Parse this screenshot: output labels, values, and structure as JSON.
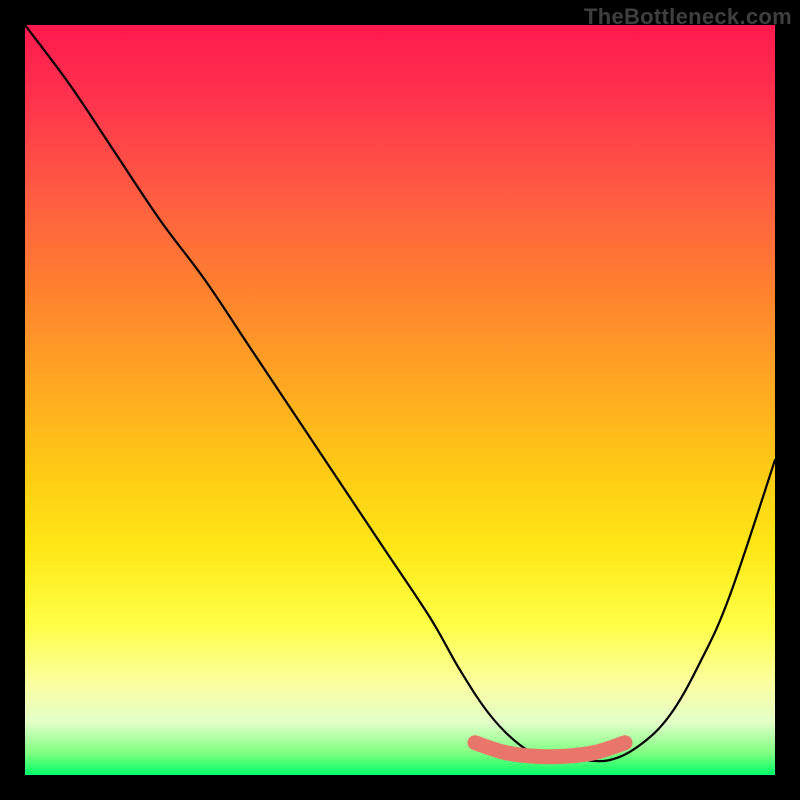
{
  "watermark": "TheBottleneck.com",
  "chart_data": {
    "type": "line",
    "title": "",
    "xlabel": "",
    "ylabel": "",
    "xlim": [
      0,
      100
    ],
    "ylim": [
      0,
      100
    ],
    "series": [
      {
        "name": "bottleneck-curve",
        "x": [
          0,
          6,
          12,
          18,
          24,
          30,
          36,
          42,
          48,
          54,
          58,
          62,
          66,
          70,
          74,
          78,
          82,
          86,
          90,
          94,
          100
        ],
        "values": [
          100,
          92,
          83,
          74,
          66,
          57,
          48,
          39,
          30,
          21,
          14,
          8,
          4,
          2,
          2,
          2,
          4,
          8,
          15,
          24,
          42
        ]
      },
      {
        "name": "optimal-band",
        "x": [
          60,
          64,
          68,
          72,
          76,
          80
        ],
        "values": [
          4.3,
          3.0,
          2.5,
          2.5,
          3.0,
          4.3
        ]
      }
    ],
    "gradient_stops": [
      {
        "pos": 0,
        "color": "#ff1a4d"
      },
      {
        "pos": 22,
        "color": "#ff5a42"
      },
      {
        "pos": 48,
        "color": "#ffa822"
      },
      {
        "pos": 70,
        "color": "#ffe817"
      },
      {
        "pos": 88,
        "color": "#fbffa2"
      },
      {
        "pos": 100,
        "color": "#00ff66"
      }
    ]
  }
}
